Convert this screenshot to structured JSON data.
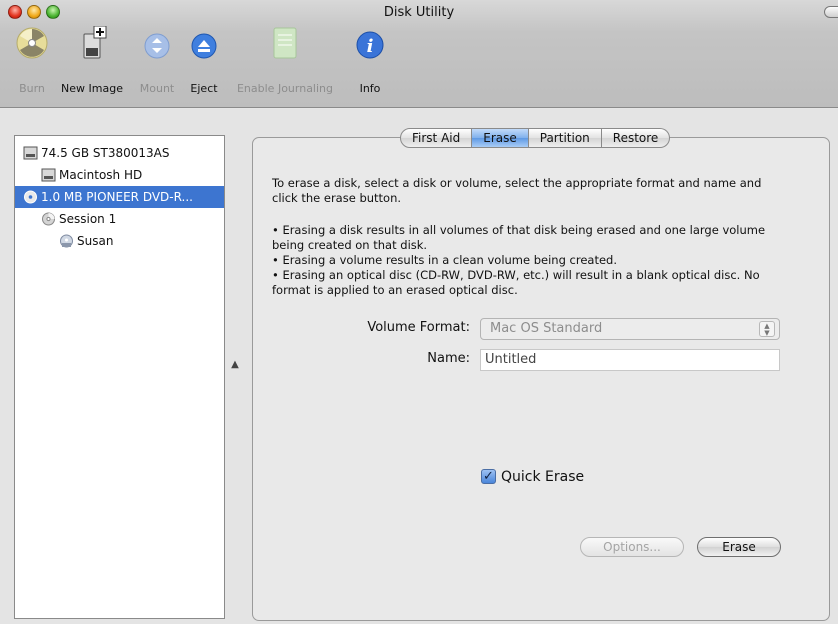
{
  "window": {
    "title": "Disk Utility"
  },
  "toolbar": {
    "items": [
      {
        "label": "Burn",
        "icon": "burn-icon",
        "enabled": false
      },
      {
        "label": "New Image",
        "icon": "new-image-icon",
        "enabled": true
      },
      {
        "label": "Mount",
        "icon": "mount-icon",
        "enabled": false
      },
      {
        "label": "Eject",
        "icon": "eject-icon",
        "enabled": true
      },
      {
        "label": "Enable Journaling",
        "icon": "journaling-icon",
        "enabled": false
      },
      {
        "label": "Info",
        "icon": "info-icon",
        "enabled": true
      }
    ]
  },
  "sidebar": {
    "items": [
      {
        "label": "74.5 GB ST380013AS",
        "icon": "hard-drive-icon",
        "level": 0,
        "selected": false
      },
      {
        "label": "Macintosh HD",
        "icon": "volume-icon",
        "level": 1,
        "selected": false
      },
      {
        "label": "1.0 MB PIONEER DVD-R...",
        "icon": "optical-drive-icon",
        "level": 0,
        "selected": true
      },
      {
        "label": "Session 1",
        "icon": "disc-session-icon",
        "level": 1,
        "selected": false
      },
      {
        "label": "Susan",
        "icon": "disc-volume-icon",
        "level": 2,
        "selected": false
      }
    ]
  },
  "tabs": [
    {
      "label": "First Aid",
      "active": false
    },
    {
      "label": "Erase",
      "active": true
    },
    {
      "label": "Partition",
      "active": false
    },
    {
      "label": "Restore",
      "active": false
    }
  ],
  "erase": {
    "intro_line1": "To erase a disk, select a disk or volume, select the appropriate format and name and",
    "intro_line2": "click the erase button.",
    "bullets": [
      {
        "line1": "• Erasing a disk results in all volumes of that disk being erased and one large volume",
        "line2": "being created on that disk."
      },
      {
        "line1": "• Erasing a volume results in a clean volume being created.",
        "line2": ""
      },
      {
        "line1": "• Erasing an optical disc (CD-RW, DVD-RW, etc.) will result in a blank optical disc.  No",
        "line2": "format is applied to an erased optical disc."
      }
    ],
    "volume_format_label": "Volume Format:",
    "volume_format_value": "Mac OS Standard",
    "name_label": "Name:",
    "name_value": "Untitled",
    "quick_erase_label": "Quick Erase",
    "quick_erase_checked": true,
    "options_button": "Options...",
    "erase_button": "Erase"
  },
  "colors": {
    "selection": "#3d75d0",
    "tab_active": "#7fb0ec"
  }
}
